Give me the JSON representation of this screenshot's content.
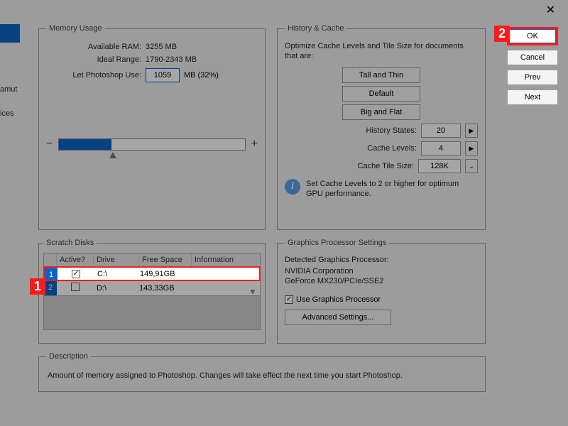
{
  "titlebar": {
    "close": "✕"
  },
  "sidebar": {
    "item1": "amut",
    "item2": "ices"
  },
  "buttons": {
    "ok": "OK",
    "cancel": "Cancel",
    "prev": "Prev",
    "next": "Next"
  },
  "memory": {
    "legend": "Memory Usage",
    "available_label": "Available RAM:",
    "available_value": "3255 MB",
    "ideal_label": "Ideal Range:",
    "ideal_value": "1790-2343 MB",
    "let_label": "Let Photoshop Use:",
    "let_value": "1059",
    "let_unit": "MB (32%)",
    "minus": "−",
    "plus": "+"
  },
  "history": {
    "legend": "History & Cache",
    "desc": "Optimize Cache Levels and Tile Size for documents that are:",
    "btn_tall": "Tall and Thin",
    "btn_default": "Default",
    "btn_big": "Big and Flat",
    "states_label": "History States:",
    "states_value": "20",
    "levels_label": "Cache Levels:",
    "levels_value": "4",
    "tile_label": "Cache Tile Size:",
    "tile_value": "128K",
    "info": "Set Cache Levels to 2 or higher for optimum GPU performance.",
    "info_icon": "i",
    "play": "▶",
    "dd": "⌄"
  },
  "scratch": {
    "legend": "Scratch Disks",
    "h_active": "Active?",
    "h_drive": "Drive",
    "h_free": "Free Space",
    "h_info": "Information",
    "rows": [
      {
        "num": "1",
        "active": true,
        "drive": "C:\\",
        "free": "149,91GB"
      },
      {
        "num": "2",
        "active": false,
        "drive": "D:\\",
        "free": "143,33GB"
      }
    ],
    "check": "✓",
    "up": "▲",
    "down": "▼"
  },
  "gpu": {
    "legend": "Graphics Processor Settings",
    "detected_label": "Detected Graphics Processor:",
    "vendor": "NVIDIA Corporation",
    "model": "GeForce MX230/PCIe/SSE2",
    "use_label": "Use Graphics Processor",
    "check": "✓",
    "adv_btn": "Advanced Settings..."
  },
  "description": {
    "legend": "Description",
    "text": "Amount of memory assigned to Photoshop. Changes will take effect the next time you start Photoshop."
  },
  "markers": {
    "m1": "1",
    "m2": "2"
  }
}
